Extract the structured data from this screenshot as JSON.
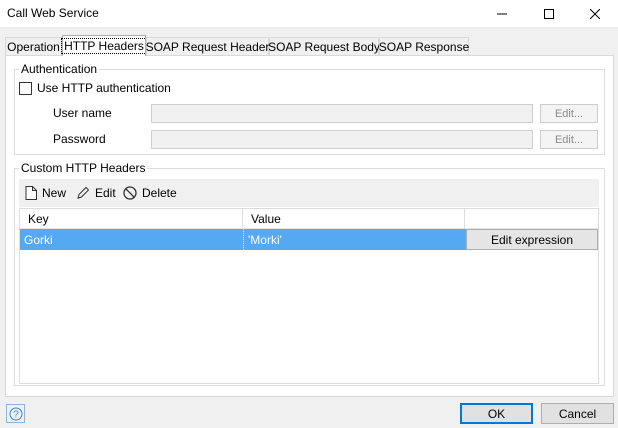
{
  "window": {
    "title": "Call Web Service",
    "controls": [
      "minimize-icon",
      "maximize-icon",
      "close-icon"
    ]
  },
  "tabs": [
    {
      "label": "Operation",
      "active": false
    },
    {
      "label": "HTTP Headers",
      "active": true
    },
    {
      "label": "SOAP Request Header",
      "active": false
    },
    {
      "label": "SOAP Request Body",
      "active": false
    },
    {
      "label": "SOAP Response",
      "active": false
    }
  ],
  "authentication": {
    "legend": "Authentication",
    "checkbox_label": "Use HTTP authentication",
    "checked": false,
    "username_label": "User name",
    "username_value": "",
    "password_label": "Password",
    "password_value": "",
    "edit_label": "Edit..."
  },
  "custom_headers": {
    "legend": "Custom HTTP Headers",
    "toolbar": {
      "new_label": "New",
      "edit_label": "Edit",
      "delete_label": "Delete"
    },
    "columns": [
      "Key",
      "Value",
      ""
    ],
    "rows": [
      {
        "key": "Gorki",
        "value": "'Morki'",
        "action": "Edit expression",
        "selected": true
      }
    ]
  },
  "footer": {
    "ok_label": "OK",
    "cancel_label": "Cancel",
    "help_icon": "help-icon"
  },
  "colors": {
    "selection": "#55a8f2",
    "focus_border": "#0078d7",
    "dialog_bg": "#f0f0f0"
  }
}
